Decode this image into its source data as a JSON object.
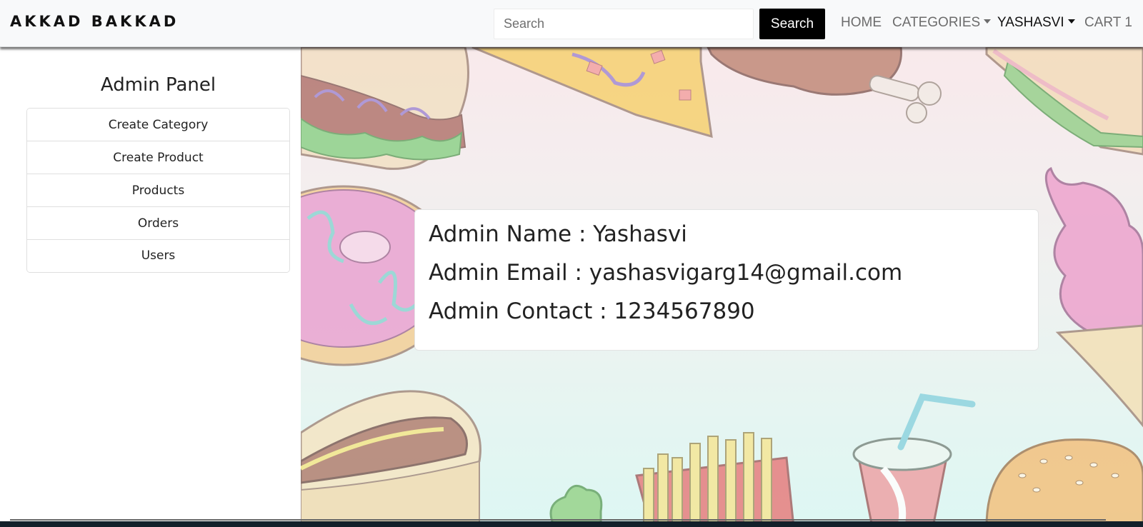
{
  "navbar": {
    "brand": "AKKAD BAKKAD",
    "search_placeholder": "Search",
    "search_button": "Search",
    "links": {
      "home": "HOME",
      "categories": "CATEGORIES",
      "user": "YASHASVI",
      "cart": "CART 1"
    }
  },
  "sidebar": {
    "title": "Admin Panel",
    "items": [
      {
        "label": "Create Category"
      },
      {
        "label": "Create Product"
      },
      {
        "label": "Products"
      },
      {
        "label": "Orders"
      },
      {
        "label": "Users"
      }
    ]
  },
  "admin_card": {
    "name_line": "Admin Name : Yashasvi",
    "email_line": "Admin Email : yashasvigarg14@gmail.com",
    "contact_line": "Admin Contact : 1234567890"
  },
  "colors": {
    "search_button_bg": "#000000",
    "navbar_bg": "#f8f9fa",
    "footer_bg": "#13202a"
  },
  "icons": {
    "dropdown": "caret-down-icon",
    "background": "food-doodle-illustration"
  }
}
